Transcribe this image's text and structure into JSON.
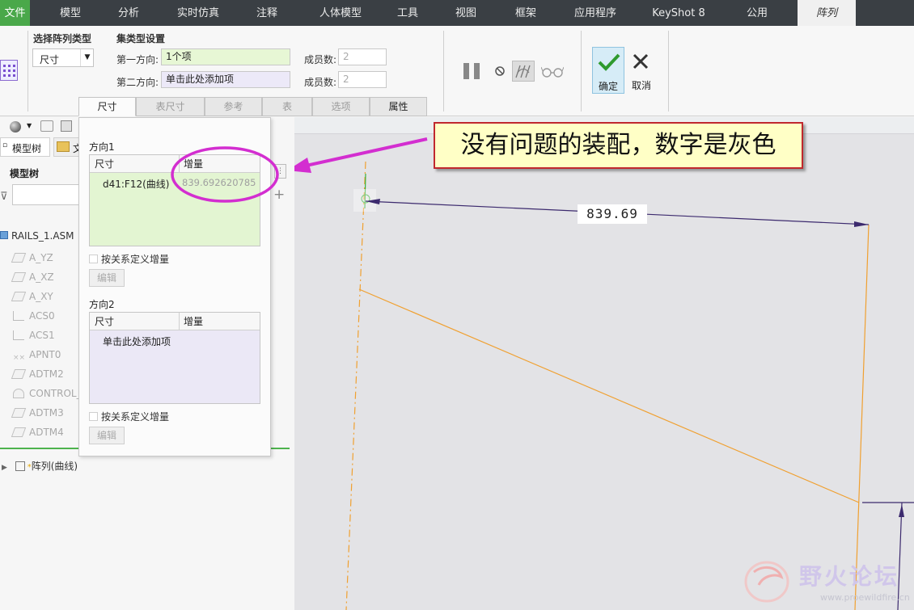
{
  "ribbon_tabs": [
    "文件",
    "模型",
    "分析",
    "实时仿真",
    "注释",
    "人体模型",
    "工具",
    "视图",
    "框架",
    "应用程序",
    "KeyShot 8",
    "公用",
    "阵列"
  ],
  "pattern_type": {
    "label": "选择阵列类型",
    "value": "尺寸"
  },
  "set_type": {
    "heading": "集类型设置",
    "dir1_label": "第一方向:",
    "dir1_value": "1个项",
    "dir2_label": "第二方向:",
    "dir2_value": "单击此处添加项",
    "members_label": "成员数:",
    "members1": "2",
    "members2": "2"
  },
  "actions": {
    "ok": "确定",
    "cancel": "取消"
  },
  "sub_tabs": [
    "尺寸",
    "表尺寸",
    "参考",
    "表",
    "选项",
    "属性"
  ],
  "panel": {
    "dir1_title": "方向1",
    "dir2_title": "方向2",
    "col_dim": "尺寸",
    "col_inc": "增量",
    "dir1_row": {
      "dim": "d41:F12(曲线)",
      "inc": "839.692620785"
    },
    "dir2_placeholder": "单击此处添加项",
    "relation_check": "按关系定义增量",
    "edit_button": "编辑"
  },
  "tree": {
    "tab_model": "模型树",
    "tab_files": "文",
    "heading": "模型树",
    "root": "RAILS_1.ASM",
    "items": [
      "A_YZ",
      "A_XZ",
      "A_XY",
      "ACS0",
      "ACS1",
      "APNT0",
      "ADTM2",
      "CONTROL_",
      "ADTM3",
      "ADTM4"
    ],
    "pattern_node": "阵列(曲线)"
  },
  "callout": "没有问题的装配，数字是灰色",
  "dimension_value": "839.69",
  "watermark": {
    "title": "野火论坛",
    "url": "www.proewildfire.cn"
  },
  "colors": {
    "accent_green": "#4aa84a",
    "callout_border": "#c0282e",
    "magenta": "#d32ed0",
    "sketch_orange": "#f0a030",
    "dim_line": "#3c2a6e"
  }
}
